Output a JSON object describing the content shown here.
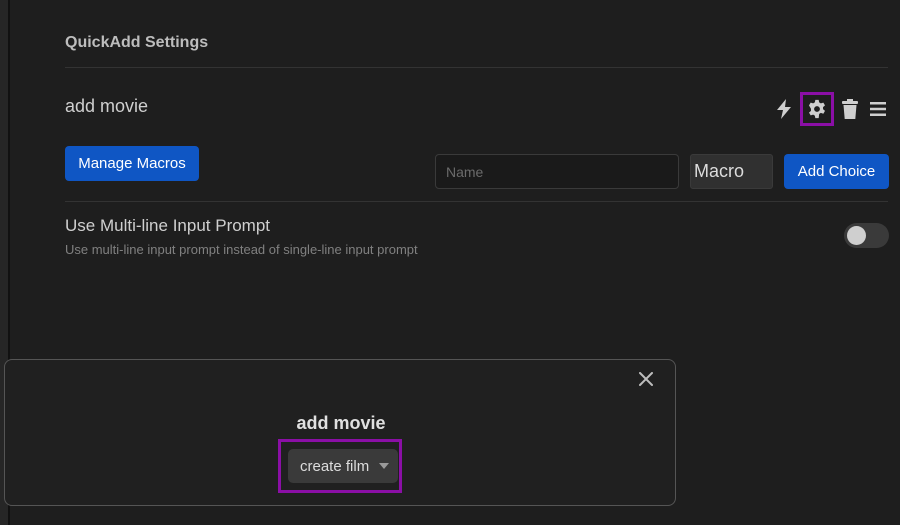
{
  "settings": {
    "title": "QuickAdd Settings"
  },
  "choice": {
    "name": "add movie",
    "actions": [
      {
        "icon": "lightning-icon"
      },
      {
        "icon": "gear-icon"
      },
      {
        "icon": "trash-icon"
      },
      {
        "icon": "drag-handle-icon"
      }
    ]
  },
  "toolbar": {
    "manage_macros_label": "Manage Macros",
    "name_placeholder": "Name",
    "type_value": "Macro",
    "add_choice_label": "Add Choice"
  },
  "multiline": {
    "title": "Use Multi-line Input Prompt",
    "description": "Use multi-line input prompt instead of single-line input prompt",
    "enabled": false
  },
  "modal": {
    "title": "add movie",
    "dropdown_value": "create film"
  },
  "colors": {
    "accent": "#0f56c4",
    "highlight": "#8b0fa6",
    "background": "#1e1e1e"
  }
}
